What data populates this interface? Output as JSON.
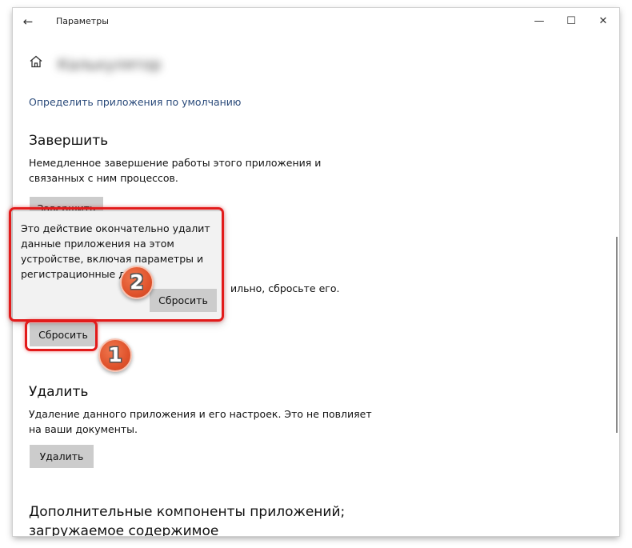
{
  "window": {
    "title": "Параметры",
    "back_glyph": "←",
    "minimize_glyph": "—",
    "maximize_glyph": "☐",
    "close_glyph": "✕"
  },
  "header": {
    "home_icon": "home-icon",
    "app_name": "Калькулятор"
  },
  "default_apps_link": "Определить приложения по умолчанию",
  "terminate": {
    "title": "Завершить",
    "description_line1": "Немедленное завершение работы этого приложения и",
    "description_line2": "связанных с ним процессов.",
    "button_label": "Завершить"
  },
  "reset": {
    "visible_tail_text": "ильно, сбросьте его.",
    "button_label": "Сбросить"
  },
  "confirm_flyout": {
    "line1": "Это действие окончательно удалит",
    "line2": "данные приложения на этом",
    "line3": "устройстве, включая параметры и",
    "line4": "регистрационные да",
    "button_label": "Сбросить"
  },
  "uninstall": {
    "title": "Удалить",
    "description_line1": "Удаление данного приложения и его настроек. Это не повлияет",
    "description_line2": "на ваши документы.",
    "button_label": "Удалить"
  },
  "addons": {
    "title_line1": "Дополнительные компоненты приложений;",
    "title_line2": "загружаемое содержимое"
  },
  "annotations": {
    "marker_1": "1",
    "marker_2": "2",
    "highlight_color": "#e21b1b",
    "marker_color": "#e0532c"
  },
  "colors": {
    "button_bg": "#cccccc",
    "link": "#2a4a7a",
    "flyout_bg": "#f2f2f2"
  }
}
